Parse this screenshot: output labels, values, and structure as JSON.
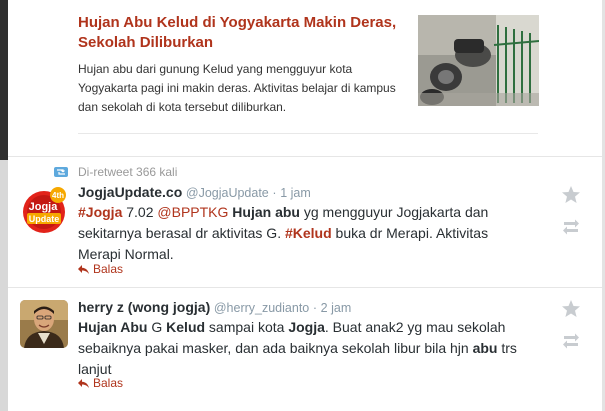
{
  "article": {
    "title": "Hujan Abu Kelud di Yogyakarta Makin Deras, Sekolah Diliburkan",
    "description": "Hujan abu dari gunung Kelud yang mengguyur kota Yogyakarta pagi ini makin deras. Aktivitas belajar di kampus dan sekolah di kota tersebut diliburkan."
  },
  "tweets": [
    {
      "retweet_text": "Di-retweet 366 kali",
      "avatar_lines": [
        "4th",
        "Jogja",
        "Update"
      ],
      "name": "JogjaUpdate.co",
      "handle": "@JogjaUpdate",
      "separator": "·",
      "time": "1 jam",
      "text": {
        "p1": "#Jogja",
        "p2": " 7.02 ",
        "p3": "@BPPTKG",
        "p4": " ",
        "p5": "Hujan abu",
        "p6": " yg mengguyur Jogjakarta dan sekitarnya berasal dr aktivitas G. ",
        "p7": "#Kelud",
        "p8": " buka dr Merapi. Aktivitas Merapi Normal."
      },
      "reply_label": "Balas"
    },
    {
      "name": "herry z (wong jogja)",
      "handle": "@herry_zudianto",
      "separator": "·",
      "time": "2 jam",
      "text": {
        "p1": "Hujan Abu",
        "p2": " G ",
        "p3": "Kelud",
        "p4": " sampai kota ",
        "p5": "Jogja",
        "p6": ". Buat anak2 yg mau sekolah sebaiknya pakai masker, dan ada baiknya sekolah libur bila hjn ",
        "p7": "abu",
        "p8": " trs lanjut"
      },
      "reply_label": "Balas"
    }
  ],
  "colors": {
    "accent": "#b0341c",
    "text": "#292f33",
    "muted": "#8899a6",
    "retweet_icon": "#5ea9dd",
    "action_icon": "#c8ccd0"
  },
  "icons": [
    "retweet-badge-icon",
    "reply-arrow-icon",
    "star-icon",
    "retweet-icon"
  ]
}
